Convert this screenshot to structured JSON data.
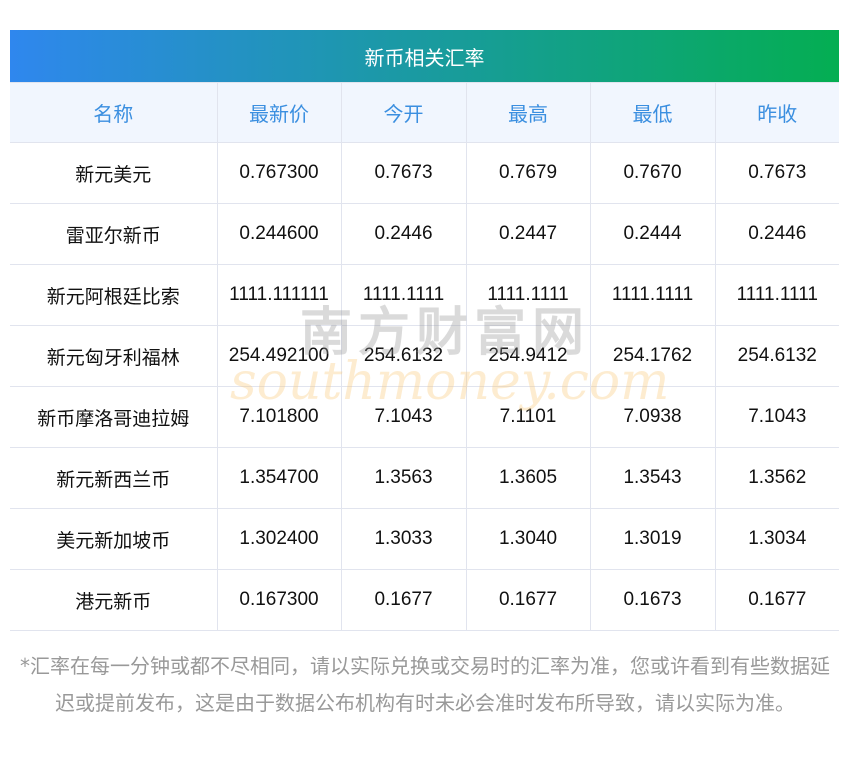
{
  "title": "新币相关汇率",
  "columns": [
    "名称",
    "最新价",
    "今开",
    "最高",
    "最低",
    "昨收"
  ],
  "rows": [
    [
      "新元美元",
      "0.767300",
      "0.7673",
      "0.7679",
      "0.7670",
      "0.7673"
    ],
    [
      "雷亚尔新币",
      "0.244600",
      "0.2446",
      "0.2447",
      "0.2444",
      "0.2446"
    ],
    [
      "新元阿根廷比索",
      "1111.111111",
      "1111.1111",
      "1111.1111",
      "1111.1111",
      "1111.1111"
    ],
    [
      "新元匈牙利福林",
      "254.492100",
      "254.6132",
      "254.9412",
      "254.1762",
      "254.6132"
    ],
    [
      "新币摩洛哥迪拉姆",
      "7.101800",
      "7.1043",
      "7.1101",
      "7.0938",
      "7.1043"
    ],
    [
      "新元新西兰币",
      "1.354700",
      "1.3563",
      "1.3605",
      "1.3543",
      "1.3562"
    ],
    [
      "美元新加坡币",
      "1.302400",
      "1.3033",
      "1.3040",
      "1.3019",
      "1.3034"
    ],
    [
      "港元新币",
      "0.167300",
      "0.1677",
      "0.1677",
      "0.1673",
      "0.1677"
    ]
  ],
  "watermark": {
    "cn": "南方财富网",
    "en": "southmoney.com"
  },
  "note": "*汇率在每一分钟或都不尽相同，请以实际兑换或交易时的汇率为准，您或许看到有些数据延迟或提前发布，这是由于数据公布机构有时未必会准时发布所导致，请以实际为准。"
}
